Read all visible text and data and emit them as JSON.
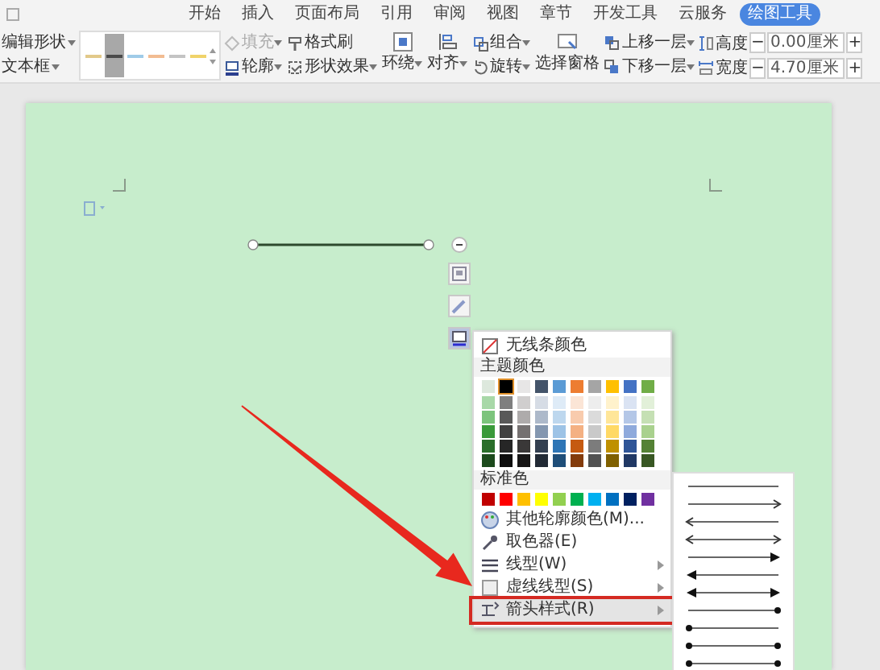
{
  "tabs": [
    {
      "label": "开始",
      "selected": false
    },
    {
      "label": "插入",
      "selected": false
    },
    {
      "label": "页面布局",
      "selected": false
    },
    {
      "label": "引用",
      "selected": false
    },
    {
      "label": "审阅",
      "selected": false
    },
    {
      "label": "视图",
      "selected": false
    },
    {
      "label": "章节",
      "selected": false
    },
    {
      "label": "开发工具",
      "selected": false
    },
    {
      "label": "云服务",
      "selected": false
    },
    {
      "label": "绘图工具",
      "selected": true
    }
  ],
  "ribbon": {
    "edit_column": [
      {
        "label": "编辑形状"
      },
      {
        "label": "文本框"
      }
    ],
    "line_styles": [
      {
        "color": "#e2c98a",
        "selected": false
      },
      {
        "color": "#4a4a4a",
        "selected": true
      },
      {
        "color": "#9fcbe8",
        "selected": false
      },
      {
        "color": "#f2bc92",
        "selected": false
      },
      {
        "color": "#c4c4c4",
        "selected": false
      },
      {
        "color": "#f0d36a",
        "selected": false
      }
    ],
    "columns": [
      {
        "kind": "stack",
        "buttons": [
          {
            "kind": "fill",
            "label": "填充",
            "caret": true,
            "disabled": true
          },
          {
            "kind": "outline",
            "label": "轮廓",
            "caret": true,
            "disabled": false
          }
        ]
      },
      {
        "kind": "stack",
        "buttons": [
          {
            "kind": "painter",
            "label": "格式刷",
            "caret": false,
            "disabled": false
          },
          {
            "kind": "effects",
            "label": "形状效果",
            "caret": true,
            "disabled": false
          }
        ]
      },
      {
        "kind": "large",
        "buttons": [
          {
            "kind": "wrap",
            "label": "环绕",
            "caret": true,
            "disabled": false
          }
        ]
      },
      {
        "kind": "large",
        "buttons": [
          {
            "kind": "align",
            "label": "对齐",
            "caret": true,
            "disabled": false
          }
        ]
      },
      {
        "kind": "stack",
        "buttons": [
          {
            "kind": "group",
            "label": "组合",
            "caret": true,
            "disabled": false
          },
          {
            "kind": "rotate",
            "label": "旋转",
            "caret": true,
            "disabled": false
          }
        ]
      },
      {
        "kind": "large",
        "buttons": [
          {
            "kind": "pane",
            "label": "选择窗格",
            "caret": false,
            "disabled": false
          }
        ]
      },
      {
        "kind": "stack",
        "buttons": [
          {
            "kind": "forward",
            "label": "上移一层",
            "caret": true,
            "disabled": false
          },
          {
            "kind": "backward",
            "label": "下移一层",
            "caret": true,
            "disabled": false
          }
        ]
      }
    ],
    "size_fields": [
      {
        "kind": "height",
        "label": "高度",
        "decrement": "−",
        "value": "0.00厘米",
        "increment": "+"
      },
      {
        "kind": "width",
        "label": "宽度",
        "decrement": "−",
        "value": "4.70厘米",
        "increment": "+"
      }
    ]
  },
  "outline_menu": {
    "no_color": "无线条颜色",
    "theme_header": "主题颜色",
    "theme_colors": [
      {
        "color": "#dde8dd",
        "selected": false,
        "shades": [
          {
            "color": "#a8d8a8"
          },
          {
            "color": "#7cc47c"
          },
          {
            "color": "#3a9a3a"
          },
          {
            "color": "#2a6e2a"
          },
          {
            "color": "#1c4a1c"
          }
        ]
      },
      {
        "color": "#000000",
        "selected": true,
        "shades": [
          {
            "color": "#7f7f7f"
          },
          {
            "color": "#595959"
          },
          {
            "color": "#404040"
          },
          {
            "color": "#262626"
          },
          {
            "color": "#0d0d0d"
          }
        ]
      },
      {
        "color": "#e7e6e6",
        "selected": false,
        "shades": [
          {
            "color": "#d0cece"
          },
          {
            "color": "#aeabab"
          },
          {
            "color": "#757171"
          },
          {
            "color": "#3a3838"
          },
          {
            "color": "#171616"
          }
        ]
      },
      {
        "color": "#44546a",
        "selected": false,
        "shades": [
          {
            "color": "#d6dce5"
          },
          {
            "color": "#adb9ca"
          },
          {
            "color": "#8497b0"
          },
          {
            "color": "#333f50"
          },
          {
            "color": "#222a35"
          }
        ]
      },
      {
        "color": "#5b9bd5",
        "selected": false,
        "shades": [
          {
            "color": "#deebf7"
          },
          {
            "color": "#bdd7ee"
          },
          {
            "color": "#9dc3e6"
          },
          {
            "color": "#2e75b6"
          },
          {
            "color": "#1f4e79"
          }
        ]
      },
      {
        "color": "#ed7d31",
        "selected": false,
        "shades": [
          {
            "color": "#fbe5d6"
          },
          {
            "color": "#f8cbad"
          },
          {
            "color": "#f4b183"
          },
          {
            "color": "#c55a11"
          },
          {
            "color": "#843c0c"
          }
        ]
      },
      {
        "color": "#a5a5a5",
        "selected": false,
        "shades": [
          {
            "color": "#ededed"
          },
          {
            "color": "#dbdbdb"
          },
          {
            "color": "#c9c9c9"
          },
          {
            "color": "#7c7c7c"
          },
          {
            "color": "#525252"
          }
        ]
      },
      {
        "color": "#ffc000",
        "selected": false,
        "shades": [
          {
            "color": "#fff2cc"
          },
          {
            "color": "#ffe699"
          },
          {
            "color": "#ffd966"
          },
          {
            "color": "#bf9000"
          },
          {
            "color": "#7f6000"
          }
        ]
      },
      {
        "color": "#4472c4",
        "selected": false,
        "shades": [
          {
            "color": "#dae3f3"
          },
          {
            "color": "#b4c7e7"
          },
          {
            "color": "#8faadc"
          },
          {
            "color": "#2f5597"
          },
          {
            "color": "#203864"
          }
        ]
      },
      {
        "color": "#70ad47",
        "selected": false,
        "shades": [
          {
            "color": "#e2f0d9"
          },
          {
            "color": "#c5e0b4"
          },
          {
            "color": "#a9d18e"
          },
          {
            "color": "#548235"
          },
          {
            "color": "#385723"
          }
        ]
      }
    ],
    "standard_header": "标准色",
    "standard_colors": [
      {
        "color": "#c00000"
      },
      {
        "color": "#ff0000"
      },
      {
        "color": "#ffc000"
      },
      {
        "color": "#ffff00"
      },
      {
        "color": "#92d050"
      },
      {
        "color": "#00b050"
      },
      {
        "color": "#00b0f0"
      },
      {
        "color": "#0070c0"
      },
      {
        "color": "#002060"
      },
      {
        "color": "#7030a0"
      }
    ],
    "items": [
      {
        "kind": "palette",
        "label": "其他轮廓颜色(M)...",
        "submenu": false,
        "highlighted": false,
        "boxed": false
      },
      {
        "kind": "eyedropper",
        "label": "取色器(E)",
        "submenu": false,
        "highlighted": false,
        "boxed": false
      },
      {
        "kind": "weight",
        "label": "线型(W)",
        "submenu": true,
        "highlighted": false,
        "boxed": false
      },
      {
        "kind": "dash",
        "label": "虚线线型(S)",
        "submenu": true,
        "highlighted": false,
        "boxed": false
      },
      {
        "kind": "arrows",
        "label": "箭头样式(R)",
        "submenu": true,
        "highlighted": true,
        "boxed": true
      }
    ]
  },
  "arrow_styles": [
    {
      "kind": "none"
    },
    {
      "kind": "open-end"
    },
    {
      "kind": "open-start"
    },
    {
      "kind": "open-both"
    },
    {
      "kind": "solid-end"
    },
    {
      "kind": "solid-start"
    },
    {
      "kind": "solid-both"
    },
    {
      "kind": "dot-end"
    },
    {
      "kind": "dot-start"
    },
    {
      "kind": "dot-both"
    },
    {
      "kind": "dot-both"
    }
  ]
}
